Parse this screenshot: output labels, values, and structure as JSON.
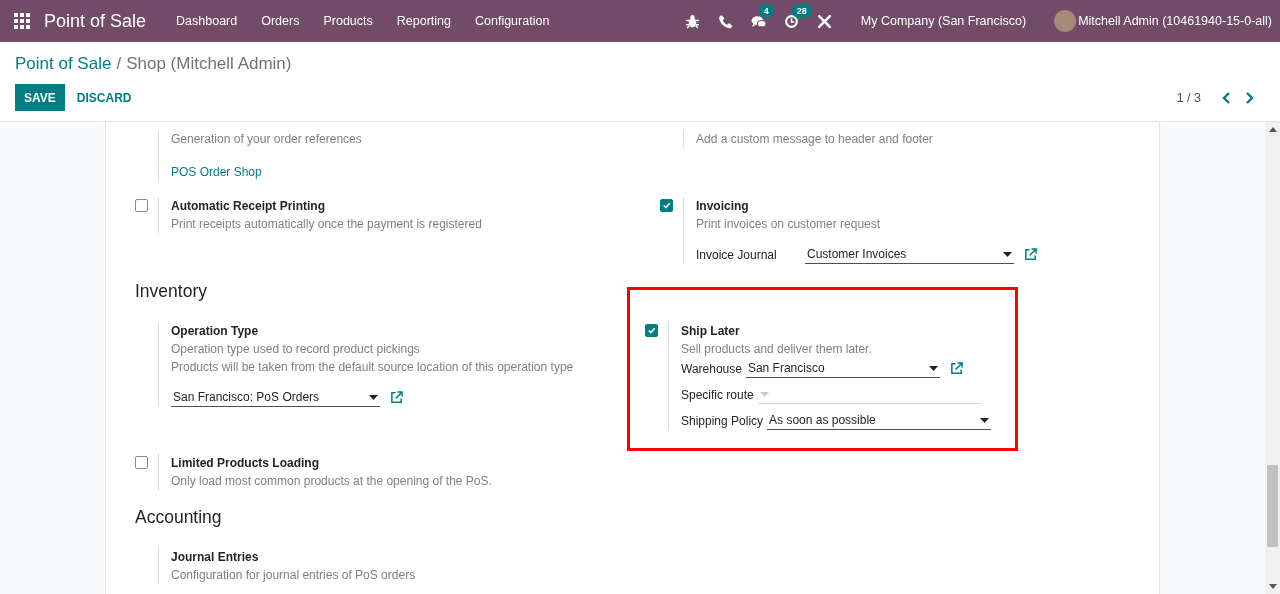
{
  "navbar": {
    "app_name": "Point of Sale",
    "menu": [
      "Dashboard",
      "Orders",
      "Products",
      "Reporting",
      "Configuration"
    ],
    "systray": [
      {
        "kind": "bug"
      },
      {
        "kind": "phone"
      },
      {
        "kind": "chat",
        "badge": "4"
      },
      {
        "kind": "activity",
        "badge": "28"
      },
      {
        "kind": "tools"
      }
    ],
    "company": "My Company (San Francisco)",
    "user": "Mitchell Admin (10461940-15-0-all)"
  },
  "breadcrumb": {
    "parent": "Point of Sale",
    "separator": "/",
    "current": "Shop (Mitchell Admin)"
  },
  "buttons": [
    {
      "kind": "primary",
      "label": "SAVE"
    },
    {
      "kind": "secondary",
      "label": "DISCARD"
    }
  ],
  "pager": {
    "value": "1 / 3"
  },
  "blocks": [
    {
      "kind": "row",
      "cells": [
        {
          "description": [
            "Generation of your order references"
          ],
          "link": "POS Order Shop"
        },
        {
          "description": [
            "Add a custom message to header and footer"
          ]
        }
      ]
    },
    {
      "kind": "row",
      "cells": [
        {
          "checked": false,
          "title": "Automatic Receipt Printing",
          "description": [
            "Print receipts automatically once the payment is registered"
          ]
        },
        {
          "checked": true,
          "title": "Invoicing",
          "description": [
            "Print invoices on customer request"
          ],
          "fields": [
            {
              "label": "Invoice Journal",
              "value": "Customer Invoices",
              "disabled": false,
              "external_link": true
            }
          ]
        }
      ]
    },
    {
      "kind": "heading",
      "text": "Inventory"
    },
    {
      "kind": "row",
      "cells": [
        {
          "title": "Operation Type",
          "description": [
            "Operation type used to record product pickings",
            "Products will be taken from the default source location of this operation type"
          ],
          "fields": [
            {
              "value": "San Francisco: PoS Orders",
              "disabled": false,
              "external_link": true
            }
          ]
        },
        {
          "checked": true,
          "highlighted": true,
          "title": "Ship Later",
          "description": [
            "Sell products and deliver them later."
          ],
          "fields": [
            {
              "label": "Warehouse",
              "value": "San Francisco",
              "disabled": false,
              "external_link": true
            },
            {
              "label": "Specific route",
              "disabled": true,
              "external_link": false
            },
            {
              "label": "Shipping Policy",
              "value": "As soon as possible",
              "disabled": false,
              "external_link": false
            }
          ]
        }
      ]
    },
    {
      "kind": "row",
      "cells": [
        {
          "checked": false,
          "title": "Limited Products Loading",
          "description": [
            "Only load most common products at the opening of the PoS."
          ]
        }
      ]
    },
    {
      "kind": "heading",
      "text": "Accounting"
    },
    {
      "kind": "row",
      "cells": [
        {
          "title": "Journal Entries",
          "description": [
            "Configuration for journal entries of PoS orders"
          ]
        }
      ]
    }
  ]
}
